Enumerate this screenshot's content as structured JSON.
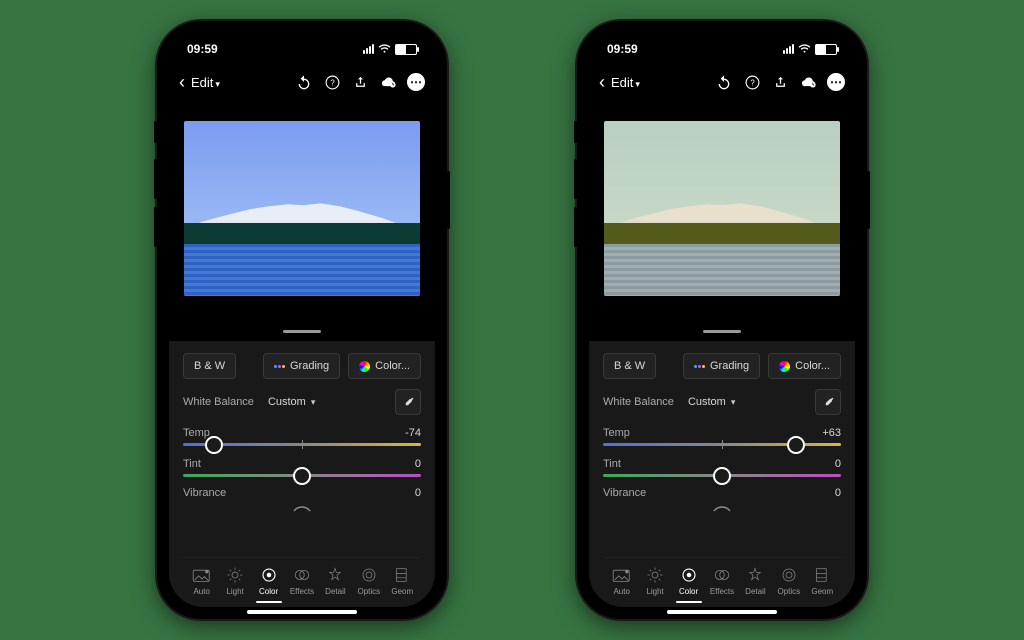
{
  "status": {
    "time": "09:59"
  },
  "topbar": {
    "edit_label": "Edit",
    "icons": {
      "back": "chevron-left",
      "undo": "undo",
      "help": "help",
      "share": "share",
      "cloud": "cloud-sync",
      "more": "more"
    }
  },
  "chips": {
    "bw": "B & W",
    "grading": "Grading",
    "color": "Color..."
  },
  "wb": {
    "label": "White Balance",
    "value": "Custom"
  },
  "sliders": {
    "temp_label": "Temp",
    "tint_label": "Tint",
    "tint_value": "0",
    "vibrance_label": "Vibrance",
    "vibrance_value": "0"
  },
  "tabs": [
    "Auto",
    "Light",
    "Color",
    "Effects",
    "Detail",
    "Optics",
    "Geom"
  ],
  "left": {
    "temp_value": "-74",
    "temp_pct": 13
  },
  "right": {
    "temp_value": "+63",
    "temp_pct": 81
  }
}
